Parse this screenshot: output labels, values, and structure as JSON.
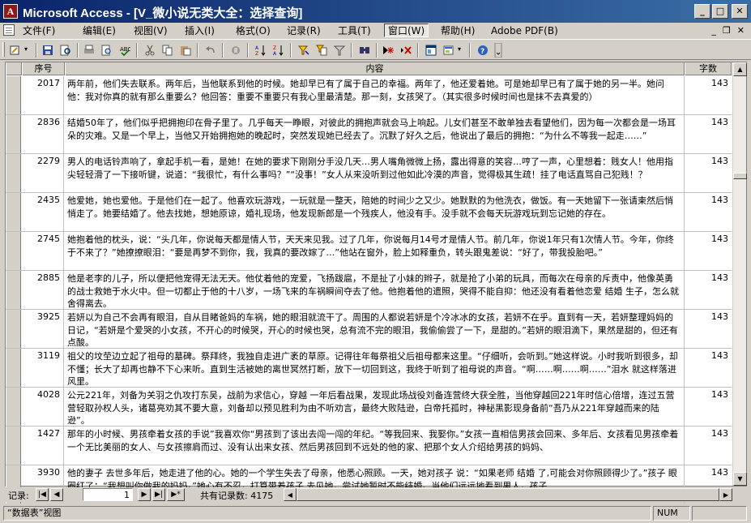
{
  "window": {
    "app_name": "Microsoft Access",
    "title": "Microsoft Access - [V_微小说无类大全：选择查询]",
    "app_icon_letter": "A"
  },
  "menu": {
    "items": [
      "文件(F)",
      "编辑(E)",
      "视图(V)",
      "插入(I)",
      "格式(O)",
      "记录(R)",
      "工具(T)",
      "窗口(W)",
      "帮助(H)",
      "Adobe PDF(B)"
    ],
    "active_index": 7
  },
  "grid": {
    "columns": [
      "序号",
      "内容",
      "字数"
    ],
    "rows": [
      {
        "id": "2017",
        "content": "两年前，他们失去联系。两年后，当他联系到他的时候。她却早已有了属于自己的幸福。两年了，他还爱着她。可是她却早已有了属于她的另一半。她问他：我对你真的就有那么重要么？他回答：重要不重要只有我心里最清楚。那一刻，女孩哭了。（其实很多时候时间也是抹不去真爱的）",
        "count": "143"
      },
      {
        "id": "2836",
        "content": "结婚50年了，他们似乎把拥抱印在骨子里了。几乎每天一睁眼，对彼此的拥抱声就会马上响起。儿女们甚至不敢单独去看望他们，因为每一次都会是一场耳朵的灾难。又是一个早上，当他又开始拥抱她的晚起时，突然发现她已经去了。沉默了好久之后，他说出了最后的拥抱：“为什么不等我一起走……”",
        "count": "143"
      },
      {
        "id": "2279",
        "content": "男人的电话铃声响了，拿起手机一看，是她！在她的要求下刚刚分手没几天…男人嘴角微微上扬，露出得意的笑容…哼了一声，心里想着：贱女人！他用指尖轻轻滑了一下接听键，说道：“我很忙，有什么事吗？”“没事！”女人从来没听到过他如此冷漠的声音，觉得极其生疏！挂了电话直骂自己犯贱！？",
        "count": "143"
      },
      {
        "id": "2435",
        "content": "他爱她，她也爱他。于是他们在一起了。他喜欢玩游戏，一玩就是一整天，陪她的时间少之又少。她默默的为他洗衣，做饭。有一天她留下一张请柬然后悄悄走了。她要结婚了。他去找她，想她原谅，婚礼现场，他发现新郎是一个残疾人，他没有手。没手就不会每天玩游戏玩到忘记她的存在。",
        "count": "143"
      },
      {
        "id": "2745",
        "content": "她抱着他的枕头，说：“头几年，你说每天都是情人节，天天来见我。过了几年，你说每月14号才是情人节。前几年，你说1年只有1次情人节。今年，你终于不来了？”她撩撩眼泪：“要是再梦不到你，我，我真的要改嫁了…”他站在窗外，脸上如释重负，转头跟鬼差说：“好了，带我投胎吧。”",
        "count": "143"
      },
      {
        "id": "2885",
        "content": "他是老李的儿子，所以便把他宠得无法无天。他仗着他的宠爱，飞扬跋扈，不是扯了小妹的辫子，就是抢了小弟的玩具，而每次在母亲的斥责中，他像英勇的战士救她于水火中。但一切都止于他的十八岁，一场飞来的车祸瞬间夺去了他。他抱着他的遗照，哭得不能自抑：他还没有看着他恋爱 结婚 生子，怎么就舍得离去。",
        "count": "143"
      },
      {
        "id": "3925",
        "content": "若妍以为自己不会再有眼泪，自从目睹爸妈的车祸，她的眼泪就流干了。周围的人都说若妍是个冷冰冰的女孩，若妍不在乎。直到有一天，若妍整理妈妈的日记，“若妍是个爱哭的小女孩，不开心的时候哭，开心的时候也哭，总有流不完的眼泪，我偷偷尝了一下，是甜的。”若妍的眼泪滴下，果然是甜的，但还有点酸。",
        "count": "143"
      },
      {
        "id": "3119",
        "content": "祖父的坟茔边立起了祖母的墓碑。祭拜终，我独自走进广袤的草原。记得往年每祭祖父后祖母都来这里。“仔细听，会听到。”她这样说。小时我听到很多，却不懂；长大了却再也静不下心来听。直到生活被她的离世冥然打断，放下一切回到这，我终于听到了祖母说的声音。“啊……啊……啊……”泪水 就这样落进风里。",
        "count": "143"
      },
      {
        "id": "4028",
        "content": "公元221年，刘备为关羽之仇攻打东吴，战前为求信心，穿越 一年后看战果，发现此场战役刘备连营终大获全胜，当他穿越回221年时信心倍增，连过五营营轻取孙权人头，诸葛亮劝其不要大意，刘备却以预见胜利为由不听劝言，最终大败陆逊，白帝托孤时，神秘黑影现身备前“吾乃从221年穿越而来的陆逊”。",
        "count": "143"
      },
      {
        "id": "1427",
        "content": "那年的小时候、男孩牵着女孩的手说”我喜欢你“男孩到了该出去闯一闯的年纪。“等我回来、我娶你。”女孩一直相信男孩会回来、多年后、女孩看见男孩牵着一个无比美丽的女人、与女孩擦肩而过、没有认出来女孩、然后男孩回到不远处的他的家、把那个女人介绍给男孩的妈妈、",
        "count": "143"
      },
      {
        "id": "3930",
        "content": "他的妻子 去世多年后，她走进了他的心。她的一个学生失去了母亲，他悉心照顾。一天，她对孩子 说：“如果老师 结婚 了,可能会对你照顾得少了。”孩子 眼圈红了：“我想叫你做我的妈妈。”她心有不忍，打算带着孩子 去见她，尝试她暂时不能结婚。当他们远远地看到男人，孩子",
        "count": "143"
      }
    ]
  },
  "navigation": {
    "label": "记录:",
    "current": "1",
    "total_text": "共有记录数: 4175"
  },
  "status": {
    "view_label": "“数据表”视图",
    "num_indicator": "NUM"
  },
  "icons": [
    "view-icon",
    "save-icon",
    "search-file-icon",
    "print-icon",
    "print-preview-icon",
    "spellcheck-icon",
    "cut-icon",
    "copy-icon",
    "paste-icon",
    "undo-icon",
    "insert-object-icon",
    "sort-asc-icon",
    "sort-desc-icon",
    "filter-by-selection-icon",
    "filter-by-form-icon",
    "apply-filter-icon",
    "find-icon",
    "new-record-icon",
    "delete-record-icon",
    "database-window-icon",
    "new-object-icon",
    "help-icon"
  ]
}
